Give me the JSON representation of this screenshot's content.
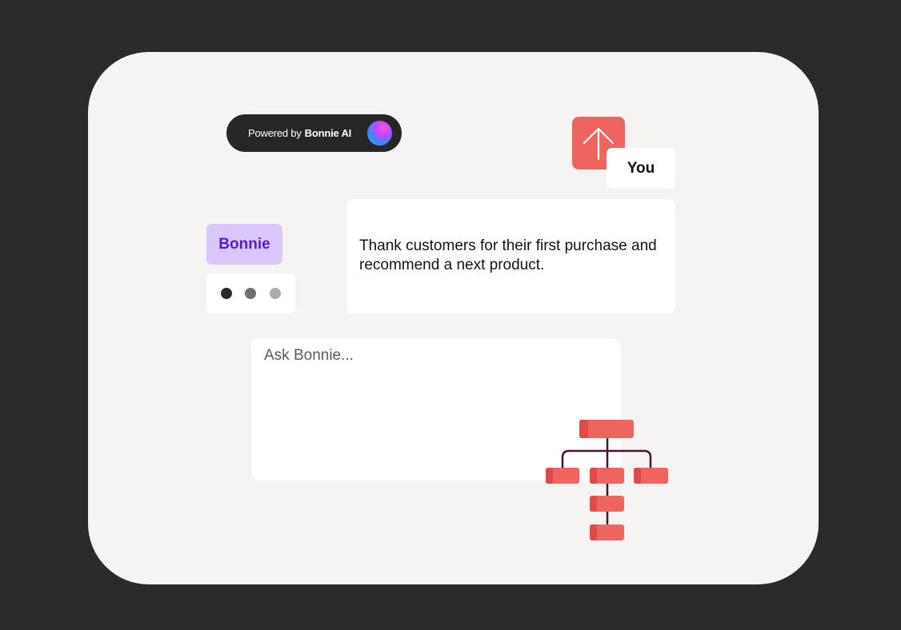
{
  "badge": {
    "prefix": "Powered by",
    "brand": "Bonnie AI",
    "icon": "gradient-orb-icon"
  },
  "send_button": {
    "icon": "arrow-up-icon"
  },
  "user_tag": {
    "label": "You"
  },
  "message": {
    "text": "Thank customers for their first purchase and recommend a next product."
  },
  "assistant_tag": {
    "label": "Bonnie"
  },
  "typing_indicator": {
    "icon": "typing-dots-icon"
  },
  "composer": {
    "placeholder": "Ask Bonnie..."
  },
  "illustration": {
    "icon": "flowchart-icon"
  },
  "colors": {
    "background": "#2a2a2a",
    "card": "#f5f4f2",
    "accent_red": "#ee6560",
    "assistant_tag_bg": "#d8c7fb",
    "assistant_tag_text": "#5a1bd0",
    "connector": "#4a1233"
  }
}
